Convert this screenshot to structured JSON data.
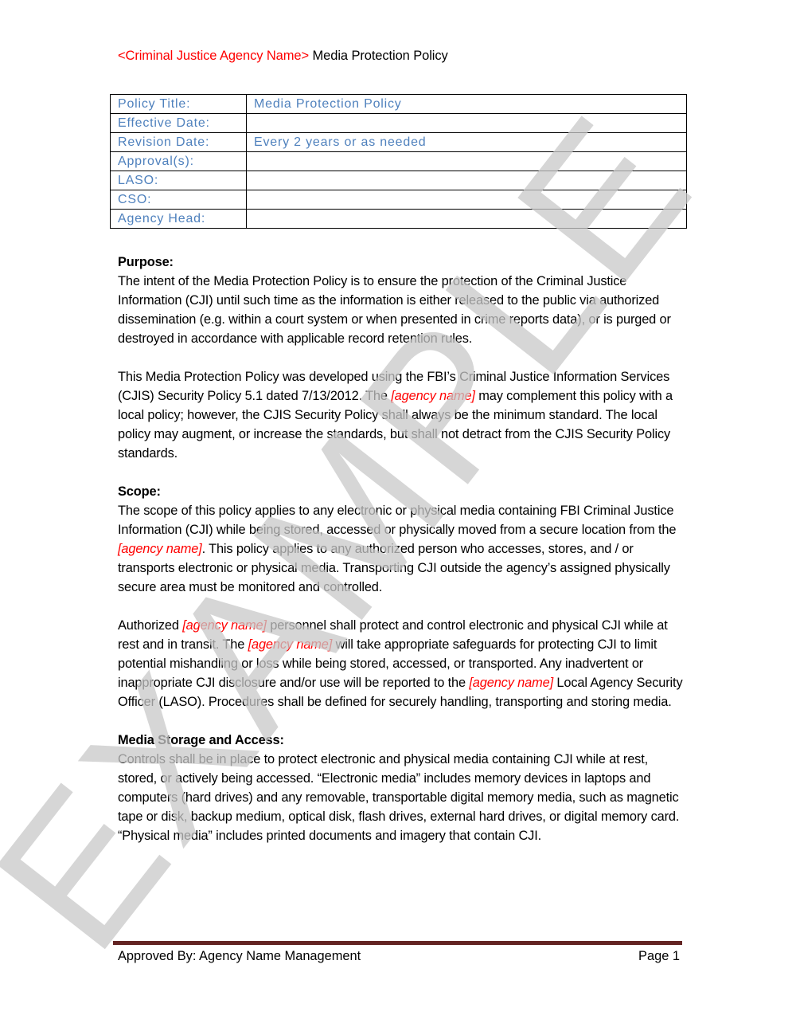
{
  "header": {
    "agency_placeholder": "<Criminal Justice Agency Name>",
    "doc_title": " Media Protection Policy"
  },
  "meta_table": {
    "rows": [
      {
        "label": "Policy Title:",
        "value": "Media Protection Policy"
      },
      {
        "label": "Effective Date:",
        "value": ""
      },
      {
        "label": "Revision Date:",
        "value": "Every 2 years or as needed"
      },
      {
        "label": "Approval(s):",
        "value": ""
      },
      {
        "label": "LASO:",
        "value": ""
      },
      {
        "label": "CSO:",
        "value": ""
      },
      {
        "label": "Agency Head:",
        "value": ""
      }
    ]
  },
  "sections": {
    "purpose": {
      "heading": "Purpose:",
      "p1": "The intent of the Media Protection Policy is to ensure the protection of the Criminal Justice Information (CJI) until such time as the information is either released to the public via authorized dissemination (e.g. within a court system or when presented in crime reports data), or is purged or destroyed in accordance with applicable record retention rules.",
      "p2_a": "This Media Protection Policy was developed using the FBI’s Criminal Justice Information Services (CJIS) Security Policy 5.1 dated 7/13/2012. The ",
      "p2_ph": "[agency name]",
      "p2_b": " may complement this policy with a local policy; however, the CJIS Security Policy shall always be the minimum standard.  The local policy may augment, or increase the standards, but shall not detract from the CJIS Security Policy standards."
    },
    "scope": {
      "heading": "Scope:",
      "p1_a": "The scope of this policy applies to any electronic or physical media containing FBI Criminal Justice Information (CJI) while being stored, accessed or physically moved from a secure location from the ",
      "p1_ph": "[agency name]",
      "p1_b": ".  This policy applies to any authorized person who accesses, stores, and / or transports electronic or physical media.  Transporting CJI outside the agency’s assigned physically secure area must be monitored and controlled.",
      "p2_a": "Authorized ",
      "p2_ph1": "[agency name]",
      "p2_b": " personnel shall protect and control electronic and physical CJI while at rest and in transit.  The ",
      "p2_ph2": "[agency name]",
      "p2_c": "  will take appropriate safeguards for protecting CJI to limit potential mishandling or loss while being stored, accessed, or transported.  Any inadvertent or inappropriate CJI disclosure and/or use will be reported to the ",
      "p2_ph3": "[agency name]",
      "p2_d": " Local Agency Security Officer (LASO).  Procedures shall be defined for securely handling, transporting and storing media."
    },
    "media_storage": {
      "heading": "Media Storage and Access:",
      "p1": "Controls shall be in place to protect electronic and physical media containing CJI while at rest, stored, or actively being accessed.  “Electronic media” includes memory devices in laptops and computers (hard drives) and any removable, transportable digital memory media, such as magnetic tape or disk, backup medium, optical disk, flash drives, external hard drives, or digital memory card. “Physical media” includes printed documents and imagery that contain CJI."
    }
  },
  "footer": {
    "approved_by": "Approved By: Agency Name Management",
    "page": "Page 1"
  },
  "watermark": {
    "text": "EXAMPLE"
  },
  "colors": {
    "placeholder_red": "#ff0000",
    "table_text_blue": "#4f81bd",
    "footer_rule": "#632423",
    "watermark_gray": "#c8c8c8"
  }
}
